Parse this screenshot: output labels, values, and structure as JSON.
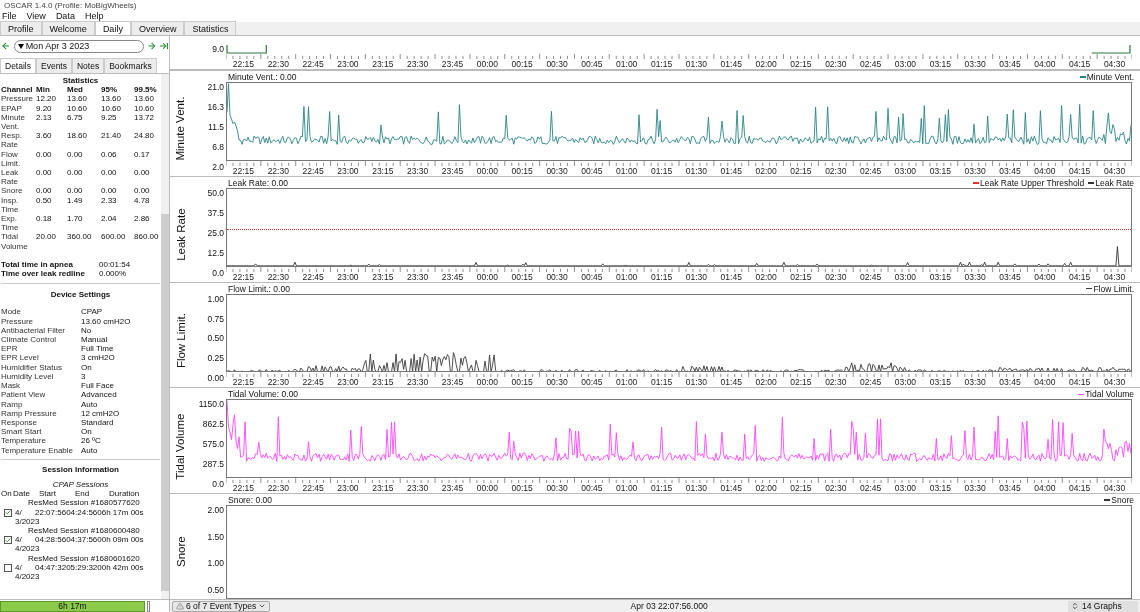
{
  "window": {
    "title": "OSCAR 1.4.0 (Profile: MoBigWheels)"
  },
  "menu": [
    "File",
    "View",
    "Data",
    "Help"
  ],
  "tabs": [
    {
      "label": "Profile",
      "selected": false
    },
    {
      "label": "Welcome",
      "selected": false
    },
    {
      "label": "Daily",
      "selected": true
    },
    {
      "label": "Overview",
      "selected": false
    },
    {
      "label": "Statistics",
      "selected": false
    }
  ],
  "date_selector": {
    "value": "Mon Apr 3 2023"
  },
  "side_tabs": [
    {
      "label": "Details",
      "selected": true
    },
    {
      "label": "Events",
      "selected": false
    },
    {
      "label": "Notes",
      "selected": false
    },
    {
      "label": "Bookmarks",
      "selected": false
    }
  ],
  "statistics": {
    "title": "Statistics",
    "columns": [
      "Channel",
      "Min",
      "Med",
      "95%",
      "99.5%"
    ],
    "rows": [
      [
        "Pressure",
        "12.20",
        "13.60",
        "13.60",
        "13.60"
      ],
      [
        "EPAP",
        "9.20",
        "10.60",
        "10.60",
        "10.60"
      ],
      [
        "Minute Vent.",
        "2.13",
        "6.75",
        "9.25",
        "13.72"
      ],
      [
        "Resp. Rate",
        "3.60",
        "18.60",
        "21.40",
        "24.80"
      ],
      [
        "Flow Limit.",
        "0.00",
        "0.00",
        "0.06",
        "0.17"
      ],
      [
        "Leak Rate",
        "0.00",
        "0.00",
        "0.00",
        "0.00"
      ],
      [
        "Snore",
        "0.00",
        "0.00",
        "0.00",
        "0.00"
      ],
      [
        "Insp. Time",
        "0.50",
        "1.49",
        "2.33",
        "4.78"
      ],
      [
        "Exp. Time",
        "0.18",
        "1.70",
        "2.04",
        "2.86"
      ],
      [
        "Tidal Volume",
        "20.00",
        "360.00",
        "600.00",
        "860.00"
      ]
    ],
    "totals": [
      {
        "label": "Total time in apnea",
        "value": "00:01:54"
      },
      {
        "label": "Time over leak redline",
        "value": "0.000%"
      }
    ]
  },
  "device_settings": {
    "title": "Device Settings",
    "rows": [
      {
        "label": "Mode",
        "value": "CPAP"
      },
      {
        "label": "Pressure",
        "value": "13.60 cmH2O"
      },
      {
        "label": "Antibacterial Filter",
        "value": "No"
      },
      {
        "label": "Climate Control",
        "value": "Manual"
      },
      {
        "label": "EPR",
        "value": "Full Time"
      },
      {
        "label": "EPR Level",
        "value": "3 cmH2O"
      },
      {
        "label": "Humidifier Status",
        "value": "On"
      },
      {
        "label": "Humidity Level",
        "value": "3"
      },
      {
        "label": "Mask",
        "value": "Full Face"
      },
      {
        "label": "Patient View",
        "value": "Advanced"
      },
      {
        "label": "Ramp",
        "value": "Auto"
      },
      {
        "label": "Ramp Pressure",
        "value": "12 cmH2O"
      },
      {
        "label": "Response",
        "value": "Standard"
      },
      {
        "label": "Smart Start",
        "value": "On"
      },
      {
        "label": "Temperature",
        "value": "26 ºC"
      },
      {
        "label": "Temperature Enable",
        "value": "Auto"
      }
    ]
  },
  "session_information": {
    "title": "Session Information",
    "subtitle": "CPAP Sessions",
    "columns": [
      "On",
      "Date",
      "Start",
      "End",
      "Duration"
    ],
    "sessions": [
      {
        "name": "ResMed Session #1680577620",
        "checked": true,
        "date": "4/ 3/2023",
        "start": "22:07:56",
        "end": "04:24:56",
        "duration": "06h 17m 00s"
      },
      {
        "name": "ResMed Session #1680600480",
        "checked": true,
        "date": "4/ 4/2023",
        "start": "04:28:56",
        "end": "04:37:56",
        "duration": "00h 09m 00s"
      },
      {
        "name": "ResMed Session #1680601620",
        "checked": false,
        "date": "4/ 4/2023",
        "start": "04:47:32",
        "end": "05:29:32",
        "duration": "00h 42m 00s"
      }
    ]
  },
  "usage_bar": {
    "label": "6h 17m"
  },
  "overview": {
    "yticks": [
      "9.0"
    ],
    "xticks": [
      "22:15",
      "22:30",
      "22:45",
      "23:00",
      "23:15",
      "23:30",
      "23:45",
      "00:00",
      "00:15",
      "00:30",
      "00:45",
      "01:00",
      "01:15",
      "01:30",
      "01:45",
      "02:00",
      "02:15",
      "02:30",
      "02:45",
      "03:00",
      "03:15",
      "03:30",
      "03:45",
      "04:00",
      "04:15",
      "04:30"
    ]
  },
  "graphs": [
    {
      "kind": "dense",
      "axis_label": "Minute Vent.",
      "header": "Minute Vent.: 0.00",
      "threshold": false,
      "legend": [
        {
          "label": "Minute Vent.",
          "color": "#2a8585"
        }
      ],
      "yticks": [
        "21.0",
        "16.3",
        "11.5",
        "6.8",
        "2.0"
      ],
      "xticks": [
        "22:15",
        "22:30",
        "22:45",
        "23:00",
        "23:15",
        "23:30",
        "23:45",
        "00:00",
        "00:15",
        "00:30",
        "00:45",
        "01:00",
        "01:15",
        "01:30",
        "01:45",
        "02:00",
        "02:15",
        "02:30",
        "02:45",
        "03:00",
        "03:15",
        "03:30",
        "03:45",
        "04:00",
        "04:15",
        "04:30"
      ]
    },
    {
      "kind": "sparse",
      "axis_label": "Leak Rate",
      "header": "Leak Rate: 0.00",
      "threshold": true,
      "legend": [
        {
          "label": "Leak Rate Upper Threshold",
          "color": "#e03030"
        },
        {
          "label": "Leak Rate",
          "color": "#333333"
        }
      ],
      "yticks": [
        "50.0",
        "37.5",
        "25.0",
        "12.5",
        "0.0"
      ],
      "xticks": [
        "22:15",
        "22:30",
        "22:45",
        "23:00",
        "23:15",
        "23:30",
        "23:45",
        "00:00",
        "00:15",
        "00:30",
        "00:45",
        "01:00",
        "01:15",
        "01:30",
        "01:45",
        "02:00",
        "02:15",
        "02:30",
        "02:45",
        "03:00",
        "03:15",
        "03:30",
        "03:45",
        "04:00",
        "04:15",
        "04:30"
      ]
    },
    {
      "kind": "bursts",
      "axis_label": "Flow Limit.",
      "header": "Flow Limit.: 0.00",
      "threshold": false,
      "legend": [
        {
          "label": "Flow Limit.",
          "color": "#3a3a3a"
        }
      ],
      "yticks": [
        "1.00",
        "0.75",
        "0.50",
        "0.25",
        "0.00"
      ],
      "xticks": [
        "22:15",
        "22:30",
        "22:45",
        "23:00",
        "23:15",
        "23:30",
        "23:45",
        "00:00",
        "00:15",
        "00:30",
        "00:45",
        "01:00",
        "01:15",
        "01:30",
        "01:45",
        "02:00",
        "02:15",
        "02:30",
        "02:45",
        "03:00",
        "03:15",
        "03:30",
        "03:45",
        "04:00",
        "04:15",
        "04:30"
      ]
    },
    {
      "kind": "dense",
      "axis_label": "Tidal Volume",
      "header": "Tidal Volume: 0.00",
      "threshold": false,
      "legend": [
        {
          "label": "Tidal Volume",
          "color": "#ff44ff"
        }
      ],
      "yticks": [
        "1150.0",
        "862.5",
        "575.0",
        "287.5",
        "0.0"
      ],
      "xticks": [
        "22:15",
        "22:30",
        "22:45",
        "23:00",
        "23:15",
        "23:30",
        "23:45",
        "00:00",
        "00:15",
        "00:30",
        "00:45",
        "01:00",
        "01:15",
        "01:30",
        "01:45",
        "02:00",
        "02:15",
        "02:30",
        "02:45",
        "03:00",
        "03:15",
        "03:30",
        "03:45",
        "04:00",
        "04:15",
        "04:30"
      ]
    },
    {
      "kind": "flat",
      "axis_label": "Snore",
      "header": "Snore: 0.00",
      "threshold": false,
      "legend": [
        {
          "label": "Snore",
          "color": "#333333"
        }
      ],
      "yticks": [
        "2.00",
        "1.50",
        "1.00",
        "0.50"
      ]
    }
  ],
  "status_bar": {
    "event_types": "6 of 7 Event Types",
    "time": "Apr 03 22:07:56.000",
    "graphs": "14 Graphs"
  }
}
